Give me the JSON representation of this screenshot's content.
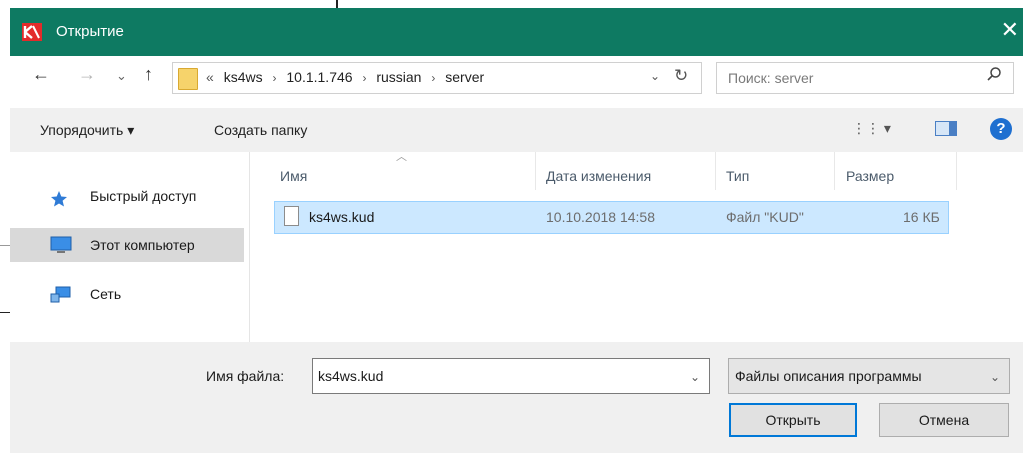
{
  "window": {
    "title": "Открытие",
    "close_glyph": "✕"
  },
  "nav": {
    "back": "←",
    "forward": "→",
    "recent": "⌄",
    "up": "↑"
  },
  "address": {
    "overflow": "«",
    "crumbs": [
      "ks4ws",
      "10.1.1.746",
      "russian",
      "server"
    ],
    "separator": "›",
    "dropdown": "⌄",
    "refresh": "↻"
  },
  "search": {
    "placeholder": "Поиск: server"
  },
  "toolbar": {
    "organize_label": "Упорядочить ▾",
    "new_folder_label": "Создать папку",
    "view_label": "⋮⋮ ▾",
    "help_label": "?"
  },
  "sidebar": {
    "items": [
      {
        "label": "Быстрый доступ",
        "icon": "star-icon"
      },
      {
        "label": "Этот компьютер",
        "icon": "computer-icon",
        "selected": true
      },
      {
        "label": "Сеть",
        "icon": "network-icon"
      }
    ]
  },
  "columns": {
    "name": "Имя",
    "date": "Дата изменения",
    "type": "Тип",
    "size": "Размер"
  },
  "files": [
    {
      "name": "ks4ws.kud",
      "date": "10.10.2018 14:58",
      "type": "Файл \"KUD\"",
      "size": "16 КБ"
    }
  ],
  "footer": {
    "filename_label": "Имя файла:",
    "filename_value": "ks4ws.kud",
    "filetype_label": "Файлы описания программы",
    "open_label": "Открыть",
    "cancel_label": "Отмена"
  },
  "colors": {
    "titlebar": "#0e7a62",
    "selection": "#cce8ff",
    "accent": "#0078d7"
  }
}
